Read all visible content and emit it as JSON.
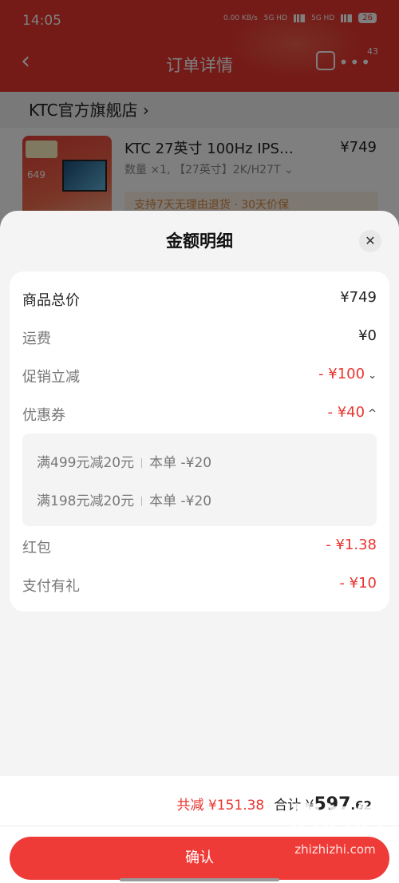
{
  "status_bar": {
    "time": "14:05",
    "net_speed": "0.00 KB/s",
    "sim1": "5G HD",
    "sim2": "5G HD",
    "battery": "26"
  },
  "nav": {
    "back_icon": "chevron-left-icon",
    "title": "订单详情",
    "share_icon": "share-icon",
    "more_icon": "more-dots-icon",
    "badge": "43"
  },
  "store": {
    "name": "KTC官方旗舰店 ›"
  },
  "product": {
    "title": "KTC 27英寸 100Hz IPS…",
    "spec": "数量 ×1, 【27英寸】2K/H27T ⌄",
    "price": "¥749",
    "thumb_price": "649",
    "service": "支持7天无理由退货 · 30天价保"
  },
  "sheet": {
    "title": "金额明细",
    "close_icon": "close-icon",
    "rows": [
      {
        "label": "商品总价",
        "value": "¥749"
      },
      {
        "label": "运费",
        "value": "¥0"
      },
      {
        "label": "促销立减",
        "value": "- ¥100",
        "chevron": "⌄"
      },
      {
        "label": "优惠券",
        "value": "- ¥40",
        "chevron": "^"
      },
      {
        "label": "红包",
        "value": "- ¥1.38"
      },
      {
        "label": "支付有礼",
        "value": "- ¥10"
      }
    ],
    "coupons": [
      {
        "name": "满499元减20元",
        "detail": "本单 -¥20"
      },
      {
        "name": "满198元减20元",
        "detail": "本单 -¥20"
      }
    ]
  },
  "footer": {
    "saved": "共减 ¥151.38",
    "total_label": "合计",
    "total_currency": "¥",
    "total_int": "597",
    "total_dec": ".62",
    "confirm": "确认"
  },
  "watermark": {
    "glyphs": "值值值",
    "domain": "zhizhizhi.com"
  },
  "colors": {
    "accent": "#e8342f",
    "button": "#ef3b37",
    "sheet_bg": "#f4f4f4"
  }
}
